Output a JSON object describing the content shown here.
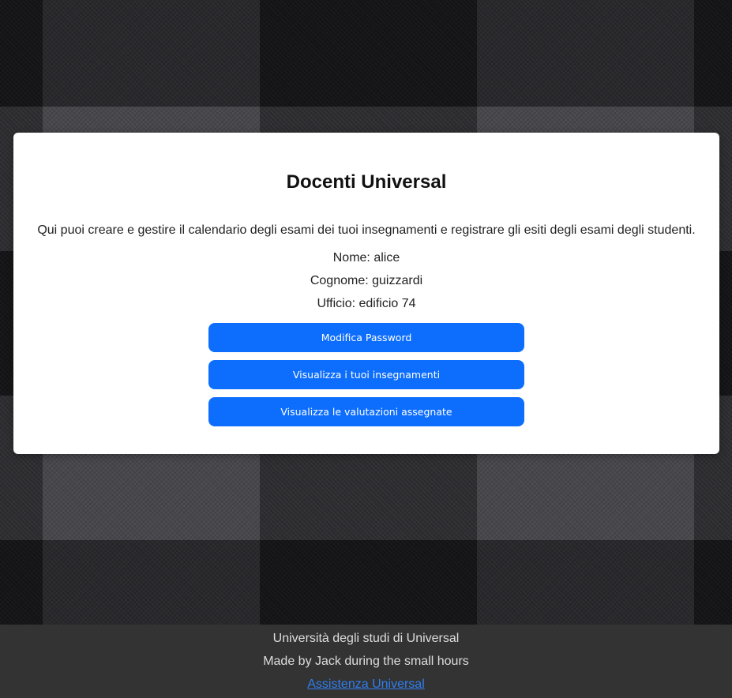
{
  "card": {
    "title": "Docenti Universal",
    "intro": "Qui puoi creare e gestire il calendario degli esami dei tuoi insegnamenti e registrare gli esiti degli esami degli studenti.",
    "nome": "Nome: alice",
    "cognome": "Cognome: guizzardi",
    "ufficio": "Ufficio: edificio 74"
  },
  "buttons": {
    "password": "Modifica Password",
    "insegnamenti": "Visualizza i tuoi insegnamenti",
    "valutazioni": "Visualizza le valutazioni assegnate"
  },
  "footer": {
    "university": "Università degli studi di Universal",
    "credits": "Made by Jack during the small hours",
    "support_link": "Assistenza Universal"
  },
  "colors": {
    "button": "#0d6efd",
    "footer_bg": "#333333",
    "link": "#2f7ff0"
  }
}
